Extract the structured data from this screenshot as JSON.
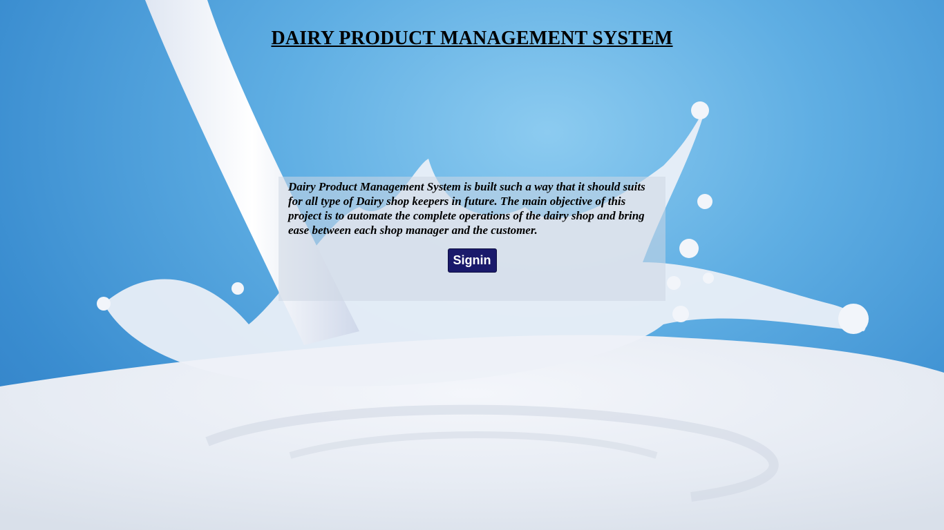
{
  "page": {
    "title": "DAIRY PRODUCT MANAGEMENT SYSTEM",
    "description": "Dairy Product Management System is built such a way that it should suits for all type of Dairy shop keepers in future. The main objective of this project is to automate the complete operations of the dairy shop and bring ease between each shop manager and the customer.",
    "signin_label": "Signin"
  },
  "colors": {
    "sky": "#5faee3",
    "milk": "#eef2f8",
    "button": "#1a1a6b"
  },
  "icons": {
    "background": "milk-splash-image"
  }
}
